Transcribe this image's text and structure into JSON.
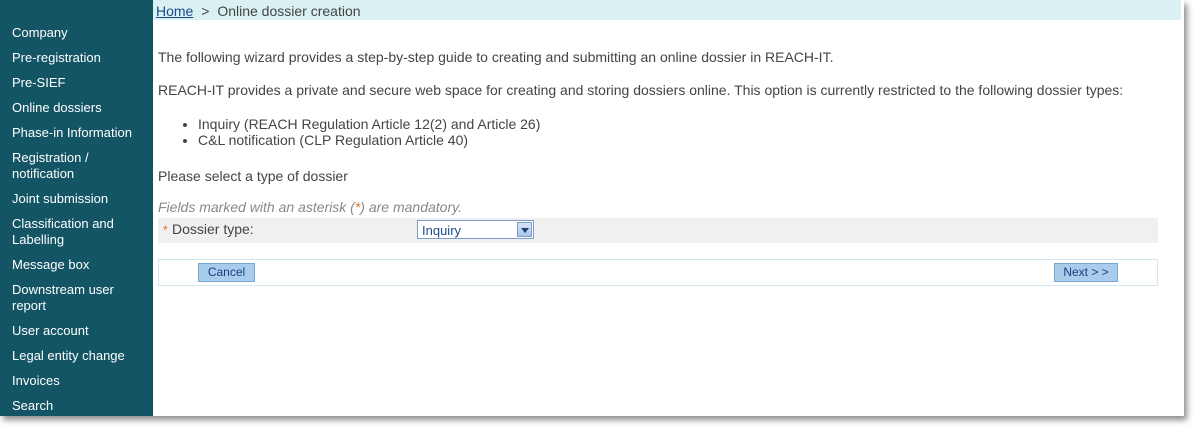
{
  "sidebar": {
    "items": [
      {
        "label": "Company"
      },
      {
        "label": "Pre-registration"
      },
      {
        "label": "Pre-SIEF"
      },
      {
        "label": "Online dossiers"
      },
      {
        "label": "Phase-in Information"
      },
      {
        "label": "Registration / notification"
      },
      {
        "label": "Joint submission"
      },
      {
        "label": "Classification and Labelling"
      },
      {
        "label": "Message box"
      },
      {
        "label": "Downstream user report"
      },
      {
        "label": "User account"
      },
      {
        "label": "Legal entity change"
      },
      {
        "label": "Invoices"
      },
      {
        "label": "Search"
      }
    ]
  },
  "breadcrumb": {
    "home": "Home",
    "separator": ">",
    "current": "Online dossier creation"
  },
  "main": {
    "intro": "The following wizard provides a step-by-step guide to creating and submitting an online dossier in REACH-IT.",
    "description": "REACH-IT provides a private and secure web space for creating and storing dossiers online. This option is currently restricted to the following dossier types:",
    "dossier_types": [
      "Inquiry (REACH Regulation Article 12(2) and Article 26)",
      "C&L notification (CLP Regulation Article 40)"
    ],
    "select_prompt": "Please select a type of dossier",
    "mandatory_note_pre": "Fields marked with an asterisk (",
    "mandatory_note_ast": "*",
    "mandatory_note_post": ") are mandatory.",
    "field": {
      "required_marker": "*",
      "label": "Dossier type:",
      "selected_value": "Inquiry"
    }
  },
  "buttons": {
    "cancel": "Cancel",
    "next": "Next > >"
  },
  "colors": {
    "sidebar_bg": "#135565",
    "breadcrumb_bg": "#d9f1f3",
    "button_bg": "#a8ccec",
    "required_marker": "#e07020"
  }
}
